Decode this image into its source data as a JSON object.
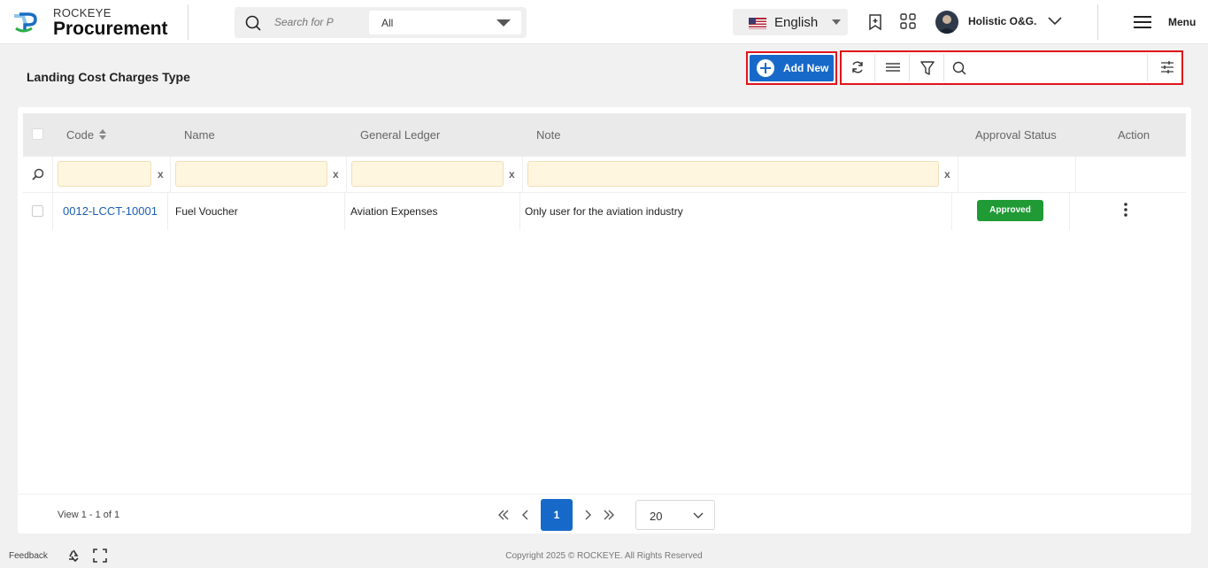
{
  "header": {
    "brand_top": "ROCKEYE",
    "brand_main": "Procurement",
    "search_placeholder": "Search for P",
    "search_scope": "All",
    "language": "English",
    "user_name": "Holistic O&G.",
    "menu_label": "Menu"
  },
  "page": {
    "title": "Landing Cost Charges Type",
    "add_new_label": "Add New"
  },
  "grid": {
    "columns": [
      "Code",
      "Name",
      "General Ledger",
      "Note",
      "Approval Status",
      "Action"
    ],
    "filter_clear": "x",
    "rows": [
      {
        "code": "0012-LCCT-10001",
        "name": "Fuel Voucher",
        "general_ledger": "Aviation Expenses",
        "note": "Only user for the aviation industry",
        "approval_status": "Approved"
      }
    ],
    "approval_color": "#1f9a34"
  },
  "pagination": {
    "view_text": "View 1 - 1 of 1",
    "current_page": "1",
    "page_size": "20"
  },
  "footer": {
    "feedback": "Feedback",
    "copyright": "Copyright 2025 © ROCKEYE. All Rights Reserved"
  },
  "colors": {
    "accent": "#1769c9",
    "highlight": "#e0141b"
  }
}
